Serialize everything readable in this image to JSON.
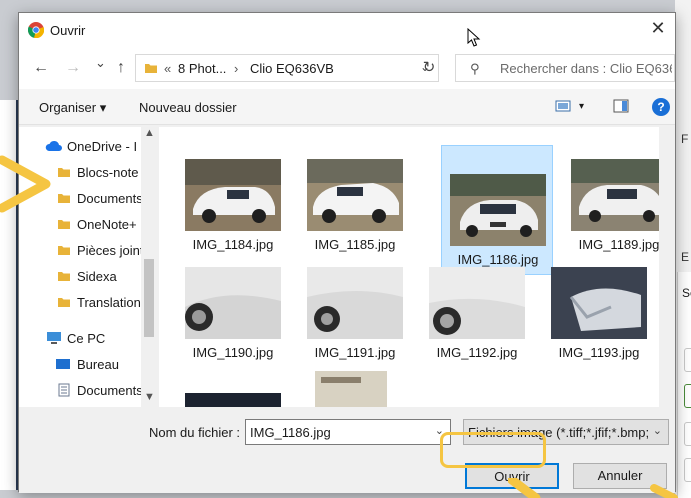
{
  "window": {
    "title": "Ouvrir",
    "close_glyph": "✕"
  },
  "navigation": {
    "back": "←",
    "forward": "→",
    "history": "⌄",
    "up": "↑",
    "breadcrumb_prefix": "«",
    "breadcrumb_parent": "8 Phot...",
    "breadcrumb_sep": "›",
    "breadcrumb_current": "Clio EQ636VB",
    "refresh_glyph": "↻",
    "search_placeholder": "Rechercher dans : Clio EQ636..."
  },
  "toolbar": {
    "organize_label": "Organiser ▾",
    "new_folder_label": "Nouveau dossier",
    "help_glyph": "?"
  },
  "sidebar": {
    "items": [
      {
        "label": "OneDrive - I",
        "icon": "cloud-icon"
      },
      {
        "label": "Blocs-note",
        "icon": "folder-icon"
      },
      {
        "label": "Documents",
        "icon": "folder-icon"
      },
      {
        "label": "OneNote+",
        "icon": "folder-icon"
      },
      {
        "label": "Pièces joint",
        "icon": "folder-icon"
      },
      {
        "label": "Sidexa",
        "icon": "folder-icon"
      },
      {
        "label": "Translation",
        "icon": "folder-icon"
      },
      {
        "label": "Ce PC",
        "icon": "computer-icon"
      },
      {
        "label": "Bureau",
        "icon": "desktop-icon"
      },
      {
        "label": "Documents",
        "icon": "document-icon"
      }
    ]
  },
  "files": [
    {
      "name": "IMG_1184.jpg"
    },
    {
      "name": "IMG_1185.jpg"
    },
    {
      "name": "IMG_1186.jpg",
      "selected": true
    },
    {
      "name": "IMG_1189.jpg"
    },
    {
      "name": "IMG_1190.jpg"
    },
    {
      "name": "IMG_1191.jpg"
    },
    {
      "name": "IMG_1192.jpg"
    },
    {
      "name": "IMG_1193.jpg"
    }
  ],
  "footer": {
    "filename_label": "Nom du fichier :",
    "filename_value": "IMG_1186.jpg",
    "filter_value": "Fichiers image (*.tiff;*.jfif;*.bmp;",
    "open_label": "Ouvrir",
    "cancel_label": "Annuler"
  },
  "background": {
    "right_frag_1": "F",
    "right_frag_2": "E",
    "right_frag_3": "Se"
  },
  "colors": {
    "accent": "#0078d7",
    "selection": "#cce8ff",
    "highlight": "#f5c542",
    "folder": "#e8b339"
  }
}
